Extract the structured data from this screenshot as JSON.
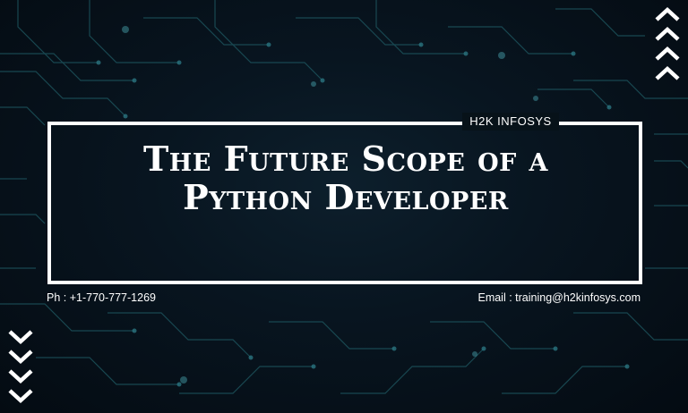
{
  "brand": "H2K INFOSYS",
  "title": {
    "line1": "The Future Scope of a",
    "line2": "Python Developer"
  },
  "contact": {
    "phone": "Ph : +1-770-777-1269",
    "email": "Email : training@h2kinfosys.com"
  },
  "colors": {
    "background": "#061019",
    "circuit": "#1f5a63",
    "text": "#ffffff"
  },
  "icons": {
    "top_right": "chevron-up-stack-icon",
    "bottom_left": "chevron-down-stack-icon"
  }
}
